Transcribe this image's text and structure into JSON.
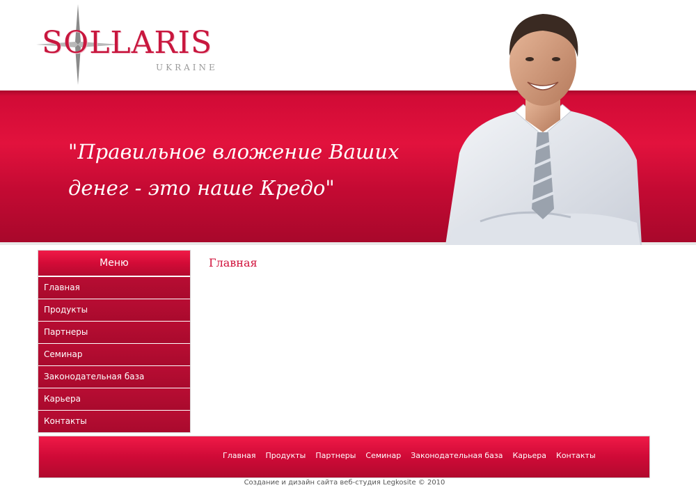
{
  "logo": {
    "name": "SOLLARIS",
    "subtitle": "UKRAINE"
  },
  "banner": {
    "slogan_line1": "\"Правильное вложение Ваших",
    "slogan_line2": "денег - это наше Кредо\""
  },
  "sidebar": {
    "title": "Меню",
    "items": [
      {
        "label": "Главная"
      },
      {
        "label": "Продукты"
      },
      {
        "label": "Партнеры"
      },
      {
        "label": "Семинар"
      },
      {
        "label": "Законодательная база"
      },
      {
        "label": "Карьера"
      },
      {
        "label": "Контакты"
      }
    ]
  },
  "main": {
    "title": "Главная"
  },
  "footer": {
    "links": [
      {
        "label": "Главная"
      },
      {
        "label": "Продукты"
      },
      {
        "label": "Партнеры"
      },
      {
        "label": "Семинар"
      },
      {
        "label": "Законодательная база"
      },
      {
        "label": "Карьера"
      },
      {
        "label": "Контакты"
      }
    ],
    "copyright": "Создание и дизайн сайта веб-студия Legkosite © 2010"
  },
  "colors": {
    "brand_red": "#c8173e",
    "banner_red": "#cf0a35",
    "menu_item_red": "#b80d33"
  }
}
